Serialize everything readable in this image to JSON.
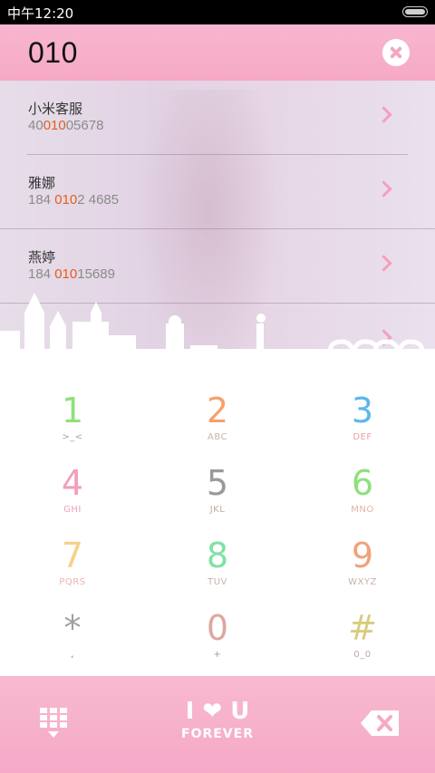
{
  "status": {
    "time": "中午12:20"
  },
  "dialer": {
    "number": "010"
  },
  "results": [
    {
      "name": "小米客服",
      "num_pre": "40",
      "num_hl": "010",
      "num_post": "05678"
    },
    {
      "name": "雅娜",
      "num_pre": "184 ",
      "num_hl": "010",
      "num_post": "2 4685"
    },
    {
      "name": "燕婷",
      "num_pre": "184 ",
      "num_hl": "010",
      "num_post": "15689"
    },
    {
      "name": "",
      "num_pre": "",
      "num_hl": "",
      "num_post": ""
    }
  ],
  "keypad": {
    "keys": [
      {
        "digit": "1",
        "letters": ">_<",
        "color": "#8fe07a",
        "letters_color": "#a7a7a7"
      },
      {
        "digit": "2",
        "letters": "ABC",
        "color": "#f7a06b",
        "letters_color": "#c9b2aa"
      },
      {
        "digit": "3",
        "letters": "DEF",
        "color": "#5bb7ea",
        "letters_color": "#e7a29f"
      },
      {
        "digit": "4",
        "letters": "GHI",
        "color": "#f0a0b8",
        "letters_color": "#f0a0b8"
      },
      {
        "digit": "5",
        "letters": "JKL",
        "color": "#9a9a9a",
        "letters_color": "#c2a7a2"
      },
      {
        "digit": "6",
        "letters": "MNO",
        "color": "#8fe07a",
        "letters_color": "#e7b1a6"
      },
      {
        "digit": "7",
        "letters": "PQRS",
        "color": "#f7d08a",
        "letters_color": "#eab4b1"
      },
      {
        "digit": "8",
        "letters": "TUV",
        "color": "#7fe2a2",
        "letters_color": "#c7b2ac"
      },
      {
        "digit": "9",
        "letters": "WXYZ",
        "color": "#f0a27d",
        "letters_color": "#c9b1a8"
      },
      {
        "digit": "*",
        "letters": ",",
        "color": "#a0a0a0",
        "letters_color": "#777777"
      },
      {
        "digit": "0",
        "letters": "+",
        "color": "#dba8a0",
        "letters_color": "#9a9a9a"
      },
      {
        "digit": "#",
        "letters": "0_0",
        "color": "#d8cc7e",
        "letters_color": "#c2a7a2"
      }
    ]
  },
  "bottom": {
    "brand_line1": "I ❤ U",
    "brand_line2": "FOREVER",
    "keypad_icon": "dialpad-icon",
    "delete_icon": "backspace-icon"
  },
  "colors": {
    "accent_pink": "#f6a9c6",
    "highlight": "#e0601c"
  }
}
